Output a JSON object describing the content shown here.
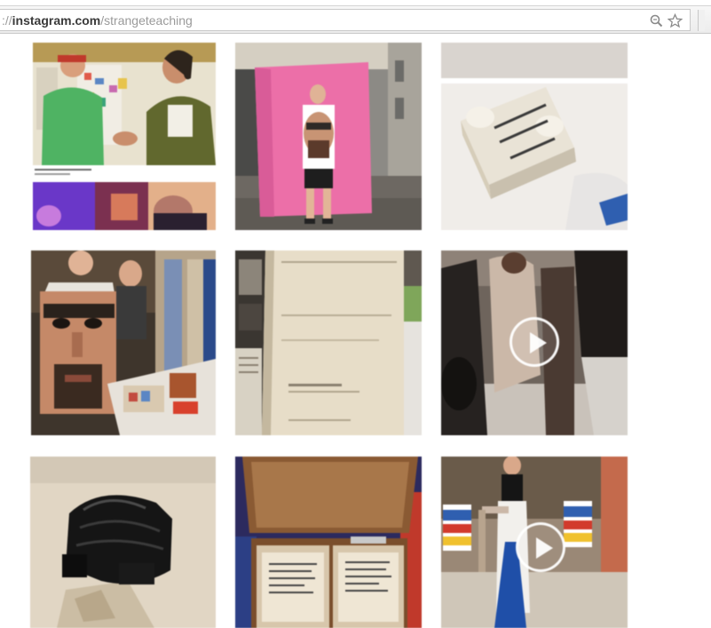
{
  "browser": {
    "url_prefix": "://",
    "url_domain": "instagram.com",
    "url_path": "/strangeteaching",
    "zoom_icon": "magnifier-icon",
    "bookmark_icon": "star-icon"
  },
  "grid": {
    "posts": [
      {
        "id": "post-1",
        "kind": "photo",
        "caption": ""
      },
      {
        "id": "post-2",
        "kind": "photo"
      },
      {
        "id": "post-3",
        "kind": "photo"
      },
      {
        "id": "post-4",
        "kind": "photo"
      },
      {
        "id": "post-5",
        "kind": "photo"
      },
      {
        "id": "post-6",
        "kind": "video",
        "overlay_icon": "play-icon"
      },
      {
        "id": "post-7",
        "kind": "photo"
      },
      {
        "id": "post-8",
        "kind": "photo"
      },
      {
        "id": "post-9",
        "kind": "video",
        "overlay_icon": "play-icon"
      }
    ]
  },
  "colors": {
    "pink_backdrop": "#ec6fa8",
    "play_overlay": "#ffffff"
  }
}
